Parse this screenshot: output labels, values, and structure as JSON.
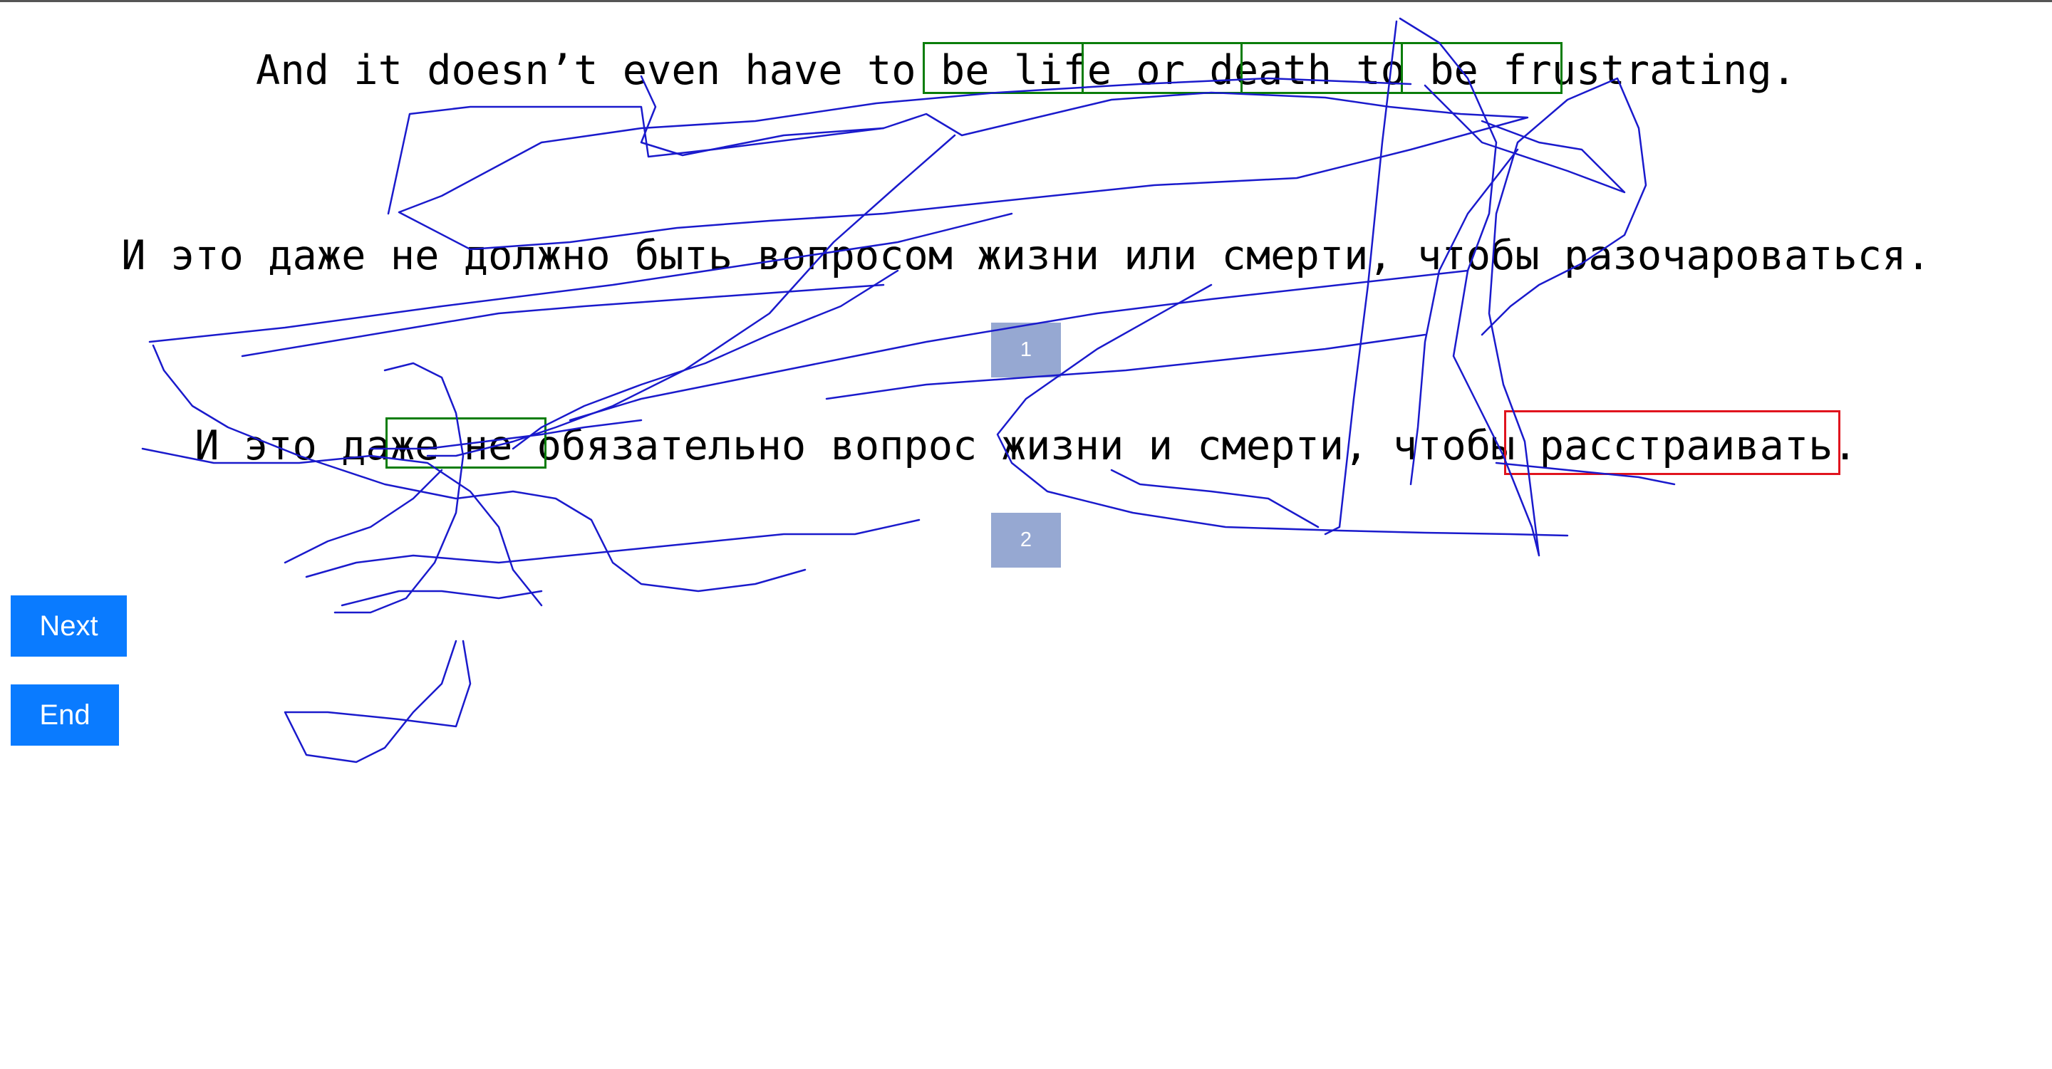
{
  "source_sentence": "And it doesn’t even have to be life or death to be frustrating.",
  "translations": [
    {
      "text": "И это даже не должно быть вопросом жизни или смерти, чтобы разочароваться.",
      "rank": "1"
    },
    {
      "text": "И это даже не обязательно вопрос жизни и смерти, чтобы расстраивать.",
      "rank": "2"
    }
  ],
  "buttons": {
    "next": "Next",
    "end": "End"
  },
  "colors": {
    "button_bg": "#0a7bff",
    "rank_badge_bg": "#96a8d2",
    "correct_highlight": "#0a7d0a",
    "error_highlight": "#e0141e",
    "pen_trace": "#1a1acc"
  }
}
